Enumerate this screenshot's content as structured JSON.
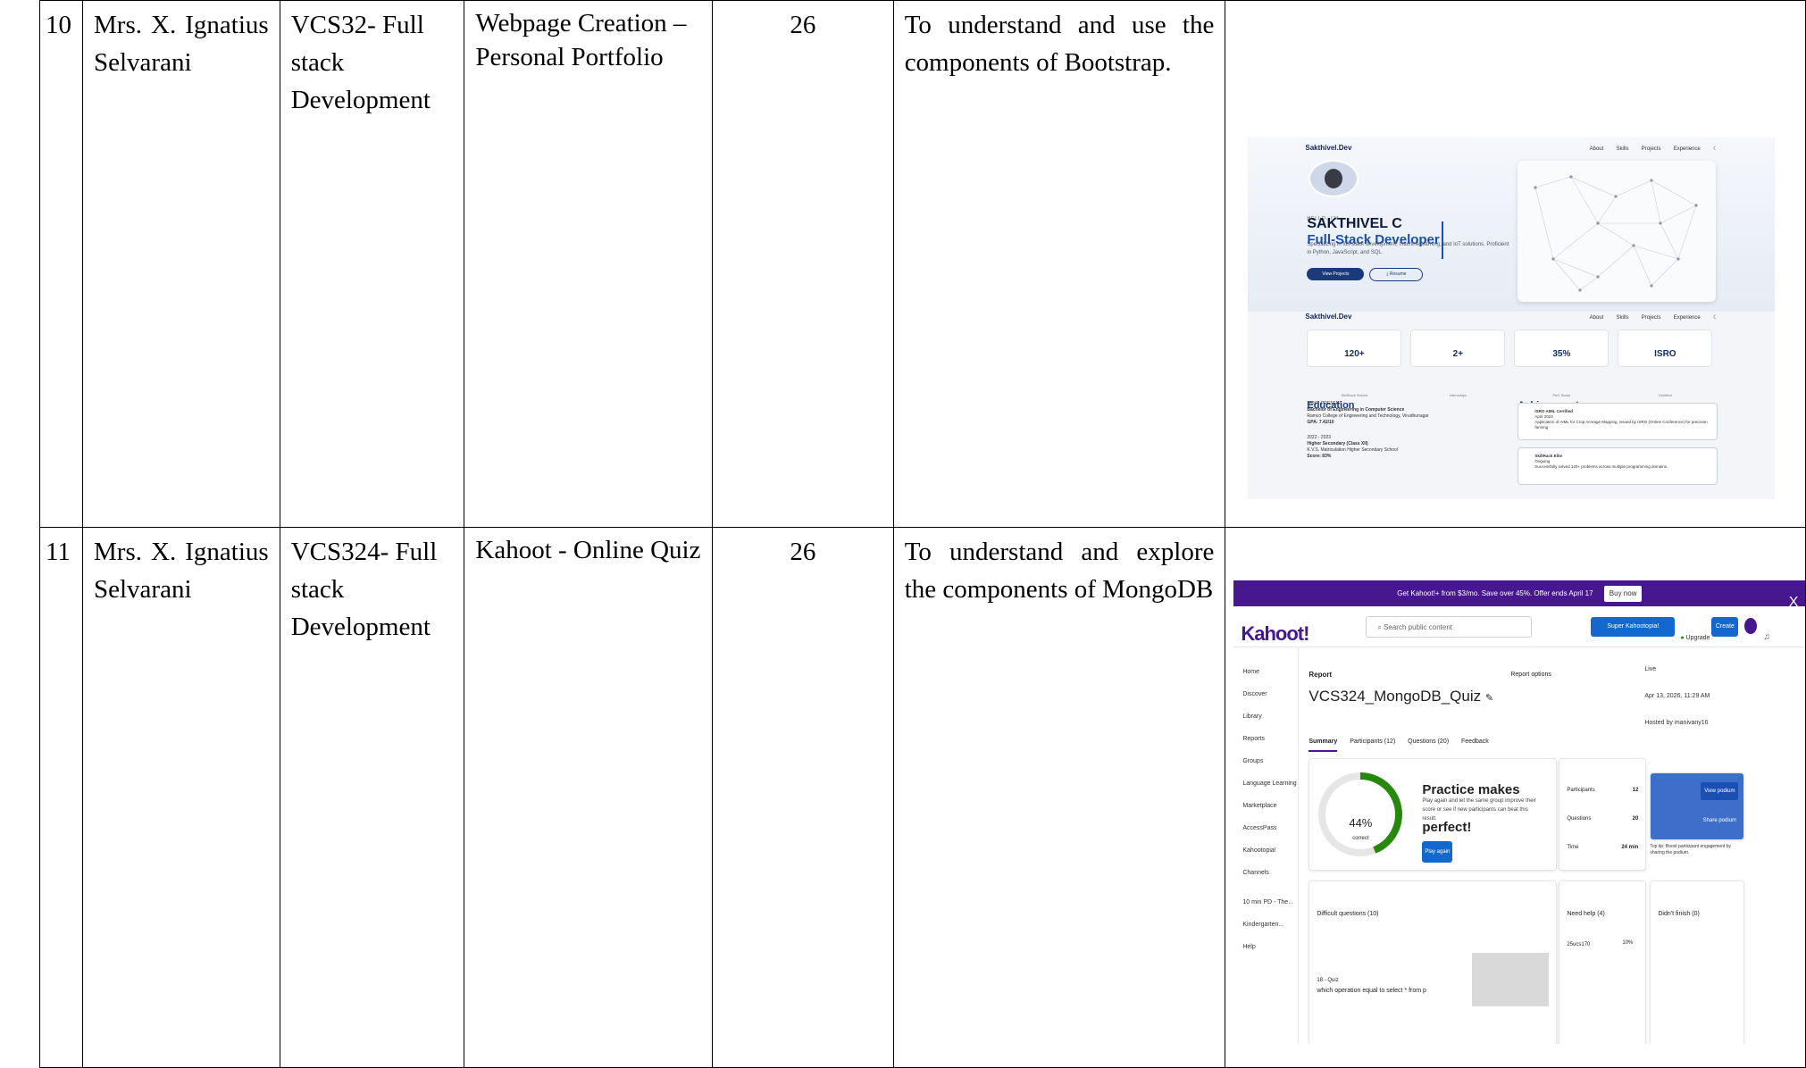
{
  "rows": [
    {
      "sno": "10",
      "staff": "Mrs.  X. Ignatius Selvarani",
      "course": "VCS32- Full stack Development",
      "activity": "Webpage Creation – Personal Portfolio",
      "count": "26",
      "objective": "To understand and use the components of Bootstrap."
    },
    {
      "sno": "11",
      "staff": "Mrs.  X. Ignatius Selvarani",
      "course": "VCS324- Full stack Development",
      "activity": "Kahoot - Online Quiz",
      "count": "26",
      "objective": "To understand and explore the components of MongoDB"
    }
  ],
  "portfolio": {
    "brand": "Sakthivel.Dev",
    "nav_links": [
      "About",
      "Skills",
      "Projects",
      "Experience"
    ],
    "hello": "HELLO, I'M",
    "name": "SAKTHIVEL C",
    "role": "Full-Stack Developer",
    "description": "Specializing in full-stack development, machine learning, and IoT solutions. Proficient in Python, JavaScript, and SQL.",
    "btn_projects": "View Projects",
    "btn_resume": "Resume",
    "stats": [
      {
        "value": "120+",
        "label": "SkillRack Solved"
      },
      {
        "value": "2+",
        "label": "Internships"
      },
      {
        "value": "35%",
        "label": "Perf. Boost"
      },
      {
        "value": "ISRO",
        "label": "Certified"
      }
    ],
    "education_title": "Education",
    "education": [
      {
        "period": "2024 - PRESENT",
        "title": "Bachelor of Engineering in Computer Science",
        "school": "Ramco College of Engineering and Technology, Virudhunagar",
        "score": "GPA: 7.42/10"
      },
      {
        "period": "2022 - 2023",
        "title": "Higher Secondary (Class XII)",
        "school": "K.V.S. Matriculation Higher Secondary School",
        "score": "Score: 83%"
      }
    ],
    "achievements_title": "Achievements",
    "achievements": [
      {
        "title": "ISRO AIML Certified",
        "date": "April 2023",
        "text": "Application of AIML for Crop Acreage Mapping, issued by ISRO (Online Conference) for precision farming"
      },
      {
        "title": "SkillRack Elite",
        "date": "Ongoing",
        "text": "Successfully solved 120+ problems across multiple programming domains."
      }
    ]
  },
  "kahoot": {
    "promo": "Get Kahoot!+ from $3/mo. Save over 45%. Offer ends April 17",
    "promo_btn": "Buy now",
    "close": "X",
    "logo": "Kahoot!",
    "search_placeholder": "Search public content",
    "super_btn": "Super Kahootopia!",
    "upgrade": "Upgrade",
    "create": "Create",
    "sidebar": [
      "Home",
      "Discover",
      "Library",
      "Reports",
      "Groups",
      "Language Learning",
      "Marketplace",
      "AccessPass",
      "Kahootopia!",
      "Channels",
      "10 min PD - The...",
      "Kindergarten...",
      "Help"
    ],
    "report_label": "Report",
    "report_options": "Report options",
    "quiz_title": "VCS324_MongoDB_Quiz",
    "tabs": [
      "Summary",
      "Participants (12)",
      "Questions (20)",
      "Feedback"
    ],
    "live": "Live",
    "date": "Apr 13, 2026, 11:29 AM",
    "hosted": "Hosted by manivany16",
    "percent": "44%",
    "percent_value": 44,
    "correct": "correct",
    "practice_title": "Practice makes perfect!",
    "practice_text": "Play again and let the same group improve their score or see if new participants can beat this result.",
    "play_again": "Play again",
    "stats": [
      {
        "label": "Participants",
        "value": "12"
      },
      {
        "label": "Questions",
        "value": "20"
      },
      {
        "label": "Time",
        "value": "24 min"
      }
    ],
    "view_podium": "View podium",
    "share_podium": "Share podium",
    "tip": "Top tip: Boost participant engagement by sharing the podium.",
    "difficult": "Difficult questions (10)",
    "need_help": "Need help (4)",
    "didnt_finish": "Didn't finish (0)",
    "q_num": "18 - Quiz",
    "q_text": "which operation equal to select * from p",
    "help_user": "25ucs170",
    "help_pct": "10%"
  }
}
